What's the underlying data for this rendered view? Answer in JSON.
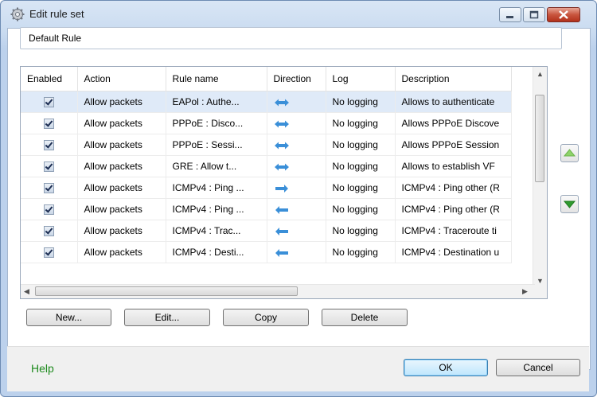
{
  "window": {
    "title": "Edit rule set"
  },
  "name_field": {
    "value": "Default Rule"
  },
  "table": {
    "columns": [
      "Enabled",
      "Action",
      "Rule name",
      "Direction",
      "Log",
      "Description"
    ],
    "rows": [
      {
        "action": "Allow packets",
        "name": "EAPol : Authe...",
        "direction": "both",
        "log": "No logging",
        "description": "Allows to authenticate",
        "selected": true
      },
      {
        "action": "Allow packets",
        "name": "PPPoE : Disco...",
        "direction": "both",
        "log": "No logging",
        "description": "Allows PPPoE Discove"
      },
      {
        "action": "Allow packets",
        "name": "PPPoE : Sessi...",
        "direction": "both",
        "log": "No logging",
        "description": "Allows PPPoE Session"
      },
      {
        "action": "Allow packets",
        "name": "GRE : Allow t...",
        "direction": "both",
        "log": "No logging",
        "description": "Allows to establish VF"
      },
      {
        "action": "Allow packets",
        "name": "ICMPv4 : Ping ...",
        "direction": "out",
        "log": "No logging",
        "description": "ICMPv4 : Ping other (R"
      },
      {
        "action": "Allow packets",
        "name": "ICMPv4 : Ping ...",
        "direction": "in",
        "log": "No logging",
        "description": "ICMPv4 : Ping other (R"
      },
      {
        "action": "Allow packets",
        "name": "ICMPv4 : Trac...",
        "direction": "in",
        "log": "No logging",
        "description": "ICMPv4 : Traceroute ti"
      },
      {
        "action": "Allow packets",
        "name": "ICMPv4 : Desti...",
        "direction": "in",
        "log": "No logging",
        "description": "ICMPv4 : Destination u"
      }
    ]
  },
  "buttons": {
    "new": "New...",
    "edit": "Edit...",
    "copy": "Copy",
    "delete": "Delete",
    "ok": "OK",
    "cancel": "Cancel"
  },
  "help": "Help",
  "colors": {
    "help": "#1d8a1d",
    "arrow": "#3a8fd8",
    "move_up": "#8fd36a",
    "move_down": "#2f9a2f"
  },
  "icons": {
    "title": "gear-icon",
    "move_up": "triangle-up-icon",
    "move_down": "triangle-down-icon"
  }
}
